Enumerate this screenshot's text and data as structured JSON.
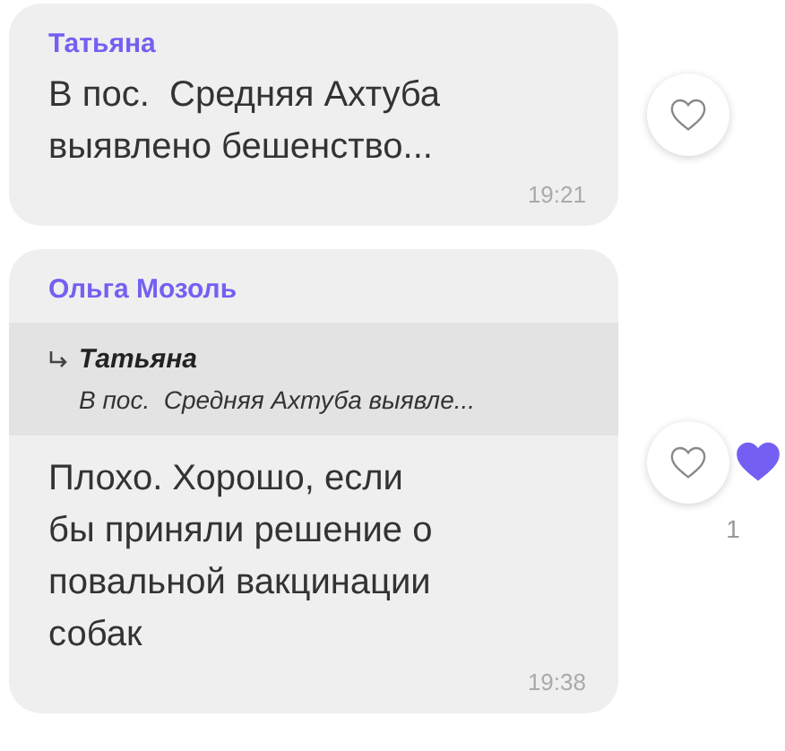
{
  "messages": [
    {
      "sender": "Татьяна",
      "text": "В пос.  Средняя Ахтуба\nвыявлено бешенство...",
      "time": "19:21",
      "like_button": {
        "selected": false
      }
    },
    {
      "sender": "Ольга Мозоль",
      "quote": {
        "sender": "Татьяна",
        "text": "В пос.  Средняя Ахтуба выявле..."
      },
      "text": "Плохо. Хорошо, если\nбы приняли решение о\nповальной вакцинации\nсобак",
      "time": "19:38",
      "like_button": {
        "selected": false
      },
      "likes": {
        "count": "1"
      }
    }
  ]
}
